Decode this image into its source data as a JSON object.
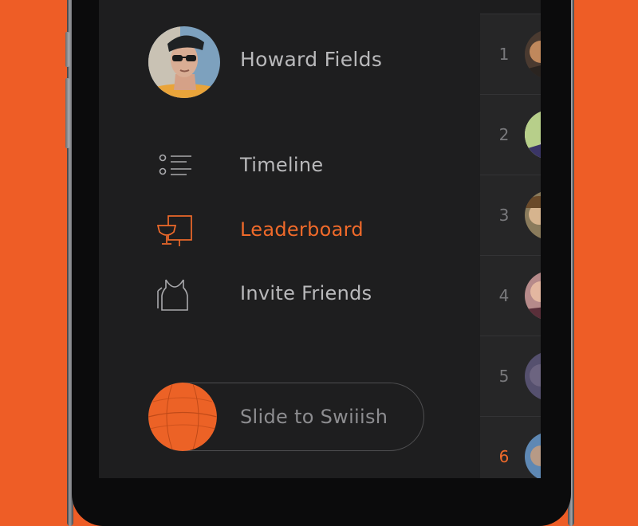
{
  "profile": {
    "name": "Howard Fields"
  },
  "menu": {
    "items": [
      {
        "label": "Timeline",
        "icon": "timeline-list-icon",
        "active": false
      },
      {
        "label": "Leaderboard",
        "icon": "trophy-board-icon",
        "active": true
      },
      {
        "label": "Invite Friends",
        "icon": "jersey-icon",
        "active": false
      }
    ]
  },
  "slider": {
    "label": "Slide to Swiiish",
    "knob_icon": "basketball-icon"
  },
  "leaderboard": {
    "ranks": [
      "1",
      "2",
      "3",
      "4",
      "5",
      "6"
    ],
    "highlighted_rank": "6"
  },
  "colors": {
    "background": "#ee5d26",
    "drawer": "#1e1e1f",
    "accent": "#f06a2a",
    "text": "#b9b9bb",
    "muted": "#8d8d90"
  }
}
